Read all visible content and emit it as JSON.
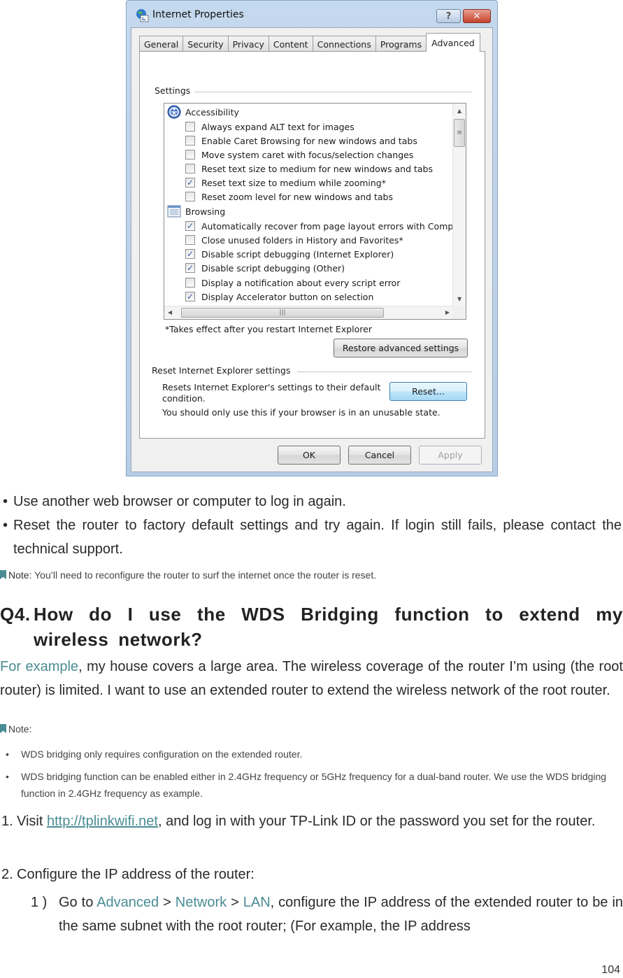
{
  "dialog": {
    "title": "Internet Properties",
    "help_glyph": "?",
    "close_glyph": "✕",
    "tabs": [
      {
        "label": "General",
        "active": false
      },
      {
        "label": "Security",
        "active": false
      },
      {
        "label": "Privacy",
        "active": false
      },
      {
        "label": "Content",
        "active": false
      },
      {
        "label": "Connections",
        "active": false
      },
      {
        "label": "Programs",
        "active": false
      },
      {
        "label": "Advanced",
        "active": true
      }
    ],
    "settings_label": "Settings",
    "settings_list": [
      {
        "type": "category",
        "icon": "accessibility-icon",
        "label": "Accessibility"
      },
      {
        "type": "checkbox",
        "label": "Always expand ALT text for images",
        "checked": false
      },
      {
        "type": "checkbox",
        "label": "Enable Caret Browsing for new windows and tabs",
        "checked": false
      },
      {
        "type": "checkbox",
        "label": "Move system caret with focus/selection changes",
        "checked": false
      },
      {
        "type": "checkbox",
        "label": "Reset text size to medium for new windows and tabs",
        "checked": false
      },
      {
        "type": "checkbox",
        "label": "Reset text size to medium while zooming*",
        "checked": true
      },
      {
        "type": "checkbox",
        "label": "Reset zoom level for new windows and tabs",
        "checked": false
      },
      {
        "type": "category",
        "icon": "browsing-icon",
        "label": "Browsing"
      },
      {
        "type": "checkbox",
        "label": "Automatically recover from page layout errors with Compa",
        "checked": true
      },
      {
        "type": "checkbox",
        "label": "Close unused folders in History and Favorites*",
        "checked": false
      },
      {
        "type": "checkbox",
        "label": "Disable script debugging (Internet Explorer)",
        "checked": true
      },
      {
        "type": "checkbox",
        "label": "Disable script debugging (Other)",
        "checked": true
      },
      {
        "type": "checkbox",
        "label": "Display a notification about every script error",
        "checked": false
      },
      {
        "type": "checkbox",
        "label": "Display Accelerator button on selection",
        "checked": true
      }
    ],
    "restart_note": "*Takes effect after you restart Internet Explorer",
    "restore_button": "Restore advanced settings",
    "reset_group_label": "Reset Internet Explorer settings",
    "reset_description_line1": "Resets Internet Explorer's settings to their default",
    "reset_description_line2": "condition.",
    "reset_button": "Reset...",
    "reset_warning": "You should only use this if your browser is in an unusable state.",
    "ok_button": "OK",
    "cancel_button": "Cancel",
    "apply_button": "Apply"
  },
  "document": {
    "bullets": [
      "Use another web browser or computer to log in again.",
      "Reset the router to factory default settings and try again. If login still fails, please contact the technical support."
    ],
    "note1": {
      "label": "Note",
      "text": ": You’ll need to reconfigure the router to surf the internet once the router is reset."
    },
    "question": {
      "number": "Q4.",
      "text": "How do I use the WDS Bridging function to extend my wireless network?"
    },
    "example_para": {
      "lead": "For example",
      "rest": ", my house covers a large area. The wireless coverage of the router I’m using (the root router) is limited. I want to use an extended router to extend the wireless network of the root router."
    },
    "note2": {
      "label": "Note:",
      "items": [
        "WDS bridging only requires configuration on the extended router.",
        "WDS bridging function can be enabled either in 2.4GHz frequency or 5GHz frequency for a dual-band router. We use the WDS bridging function in 2.4GHz frequency as example."
      ]
    },
    "steps": [
      {
        "num": "1.",
        "pre": "Visit ",
        "link": "http://tplinkwifi.net",
        "post": ", and log in with your TP-Link ID or the password you set for the router."
      },
      {
        "num": "2.",
        "text": "Configure the IP address of the router:"
      }
    ],
    "substep": {
      "num": "1 )",
      "pre": "Go to ",
      "path": [
        "Advanced",
        "Network",
        "LAN"
      ],
      "sep": " > ",
      "post": ", configure the IP address of the extended router to be in the same subnet with the root router; (For example, the IP address"
    },
    "page_number": "104",
    "accent_color": "#4a8c94"
  }
}
